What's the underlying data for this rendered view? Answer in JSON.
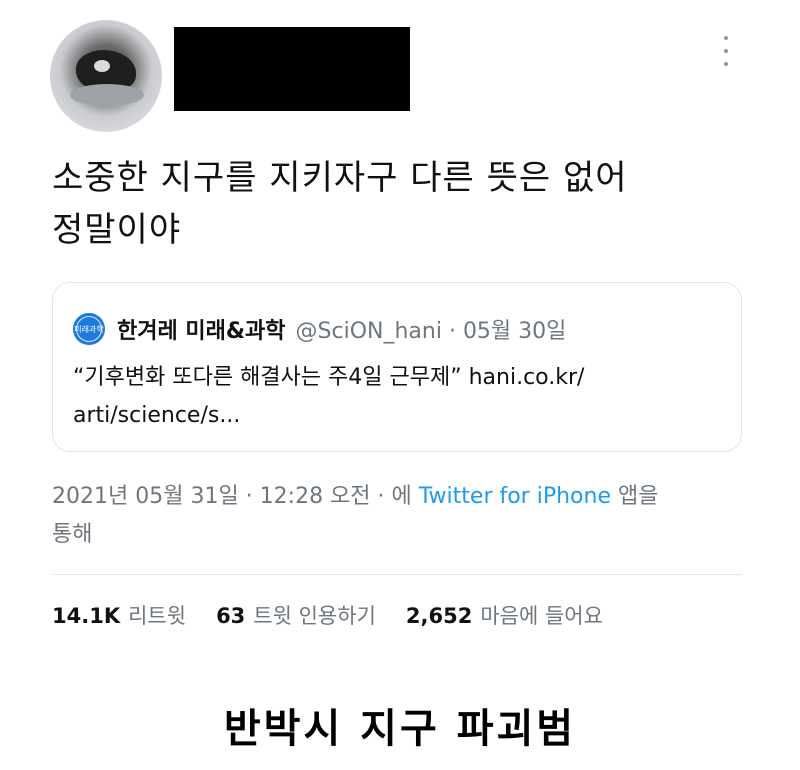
{
  "tweet": {
    "text_line1": "소중한 지구를 지키자구 다른 뜻은 없어",
    "text_line2": "정말이야",
    "quote": {
      "avatar_text": "미래과학",
      "name": "한겨레 미래&과학",
      "handle_date": "@SciON_hani · 05월 30일",
      "text_line1": "“기후변화 또다른 해결사는 주4일 근무제” hani.co.kr/",
      "text_line2": "arti/science/s..."
    },
    "timestamp_prefix": "2021년 05월 31일 · 12:28 오전 · 에 ",
    "source": "Twitter for iPhone",
    "timestamp_suffix_line1": " 앱을",
    "timestamp_suffix_line2": "통해",
    "stats": {
      "retweets_count": "14.1K",
      "retweets_label": "리트윗",
      "quotes_count": "63",
      "quotes_label": "트윗 인용하기",
      "likes_count": "2,652",
      "likes_label": "마음에 들어요"
    }
  },
  "caption": "반박시 지구 파괴범",
  "icons": {
    "more": "more-vertical-icon"
  },
  "colors": {
    "link_blue": "#1d9bf0",
    "muted": "#6e767d",
    "redaction": "#000000"
  }
}
